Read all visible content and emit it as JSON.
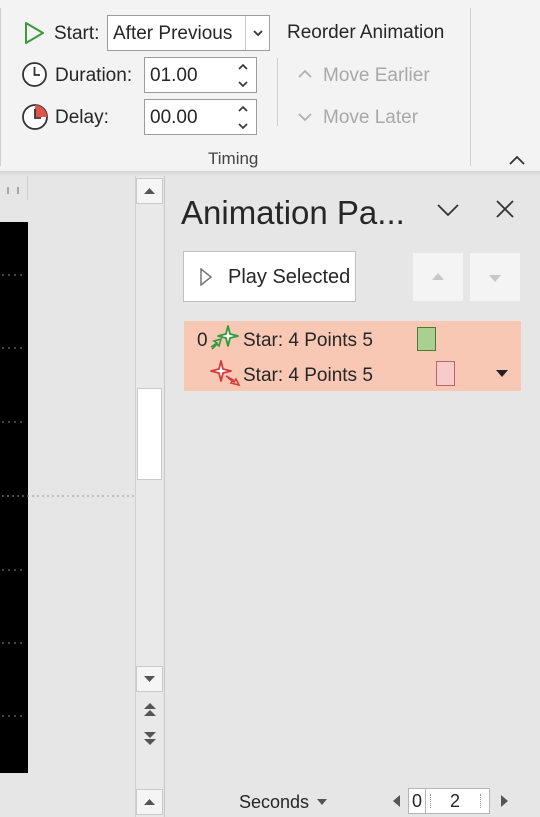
{
  "timing_group": {
    "start_label": "Start:",
    "start_value": "After Previous",
    "duration_label": "Duration:",
    "duration_value": "01.00",
    "delay_label": "Delay:",
    "delay_value": "00.00",
    "group_label": "Timing"
  },
  "reorder": {
    "title": "Reorder Animation",
    "move_earlier": "Move Earlier",
    "move_later": "Move Later"
  },
  "animation_pane": {
    "title": "Animation Pa...",
    "play_selected": "Play Selected",
    "items": [
      {
        "index": "0",
        "name": "Star: 4 Points 5",
        "type": "entrance",
        "timeline_color": "#a9d08e"
      },
      {
        "index": "",
        "name": "Star: 4 Points 5",
        "type": "exit",
        "timeline_color": "#f8cbcb"
      }
    ],
    "list_highlight_color": "#f8c8b4"
  },
  "timeline": {
    "units_label": "Seconds",
    "tick_start": "0",
    "tick_next": "2"
  },
  "icons": {
    "start": "play-triangle-icon",
    "duration": "clock-icon",
    "delay": "delay-clock-icon",
    "pane_collapse": "chevron-down-icon",
    "pane_close": "close-icon"
  }
}
